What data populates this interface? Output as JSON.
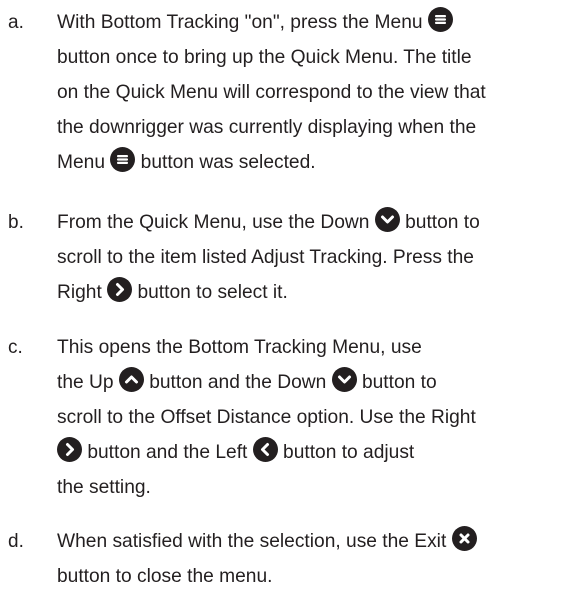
{
  "steps": [
    {
      "letter": "a.",
      "lines": [
        {
          "s1": "With Bottom Tracking \"on\", press the Menu ",
          "icon": "menu-icon"
        },
        {
          "s1": "button once to bring up the Quick Menu. The title"
        },
        {
          "s1": "on the Quick Menu will correspond to the view that"
        },
        {
          "s1": "the downrigger was currently displaying when the"
        },
        {
          "s1": "Menu ",
          "icon": "menu-icon",
          "s2": " button was selected."
        }
      ]
    },
    {
      "letter": "b.",
      "lines": [
        {
          "s1": "From the Quick Menu, use the Down ",
          "icon": "chevron-down-icon",
          "s2": " button to"
        },
        {
          "s1": "scroll to the item listed Adjust Tracking. Press the"
        },
        {
          "s1": "Right ",
          "icon": "chevron-right-icon",
          "s2": " button to select it."
        }
      ]
    },
    {
      "letter": "c.",
      "lines": [
        {
          "s1": "This opens the Bottom Tracking Menu, use"
        },
        {
          "s1": "the Up ",
          "icon": "chevron-up-icon",
          "s2": " button and the Down ",
          "icon2": "chevron-down-icon",
          "s3": " button to"
        },
        {
          "s1": "scroll to the Offset Distance option. Use the Right"
        },
        {
          "icon": "chevron-right-icon",
          "s2": " button and the Left ",
          "icon2": "chevron-left-icon",
          "s3": " button to adjust"
        },
        {
          "s1": "the setting."
        }
      ]
    },
    {
      "letter": "d.",
      "lines": [
        {
          "s1": "When satisfied with the selection, use the Exit ",
          "icon": "close-icon"
        },
        {
          "s1": "button to close the menu."
        }
      ]
    }
  ]
}
